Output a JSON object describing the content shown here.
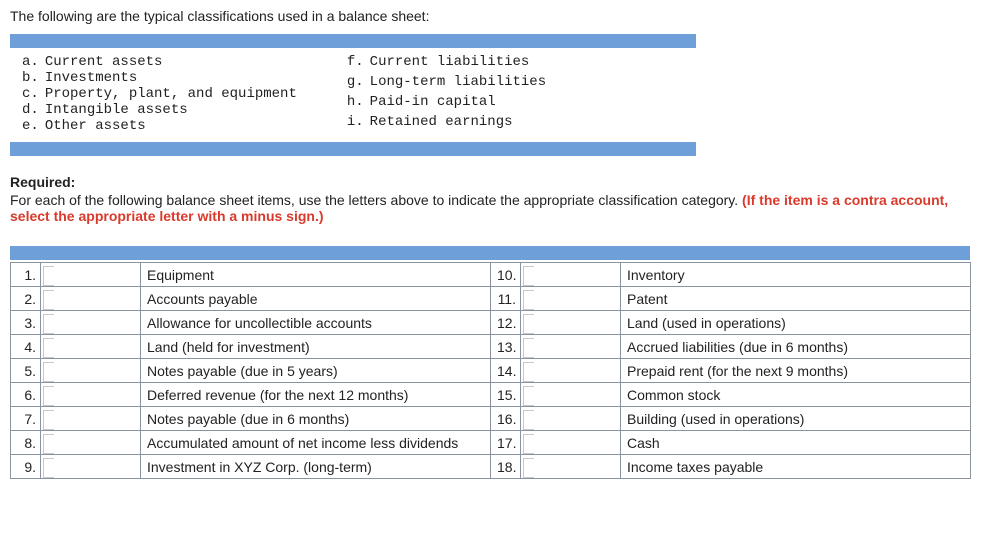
{
  "intro": "The following are the typical classifications used in a balance sheet:",
  "classifications_left": [
    {
      "letter": "a.",
      "label": "Current assets"
    },
    {
      "letter": "b.",
      "label": "Investments"
    },
    {
      "letter": "c.",
      "label": "Property, plant, and equipment"
    },
    {
      "letter": "d.",
      "label": "Intangible assets"
    },
    {
      "letter": "e.",
      "label": "Other assets"
    }
  ],
  "classifications_right": [
    {
      "letter": "f.",
      "label": "Current liabilities"
    },
    {
      "letter": "g.",
      "label": "Long-term liabilities"
    },
    {
      "letter": "h.",
      "label": "Paid-in capital"
    },
    {
      "letter": "i.",
      "label": "Retained earnings"
    }
  ],
  "required_heading": "Required:",
  "required_text": "For each of the following balance sheet items, use the letters above to indicate the appropriate classification category. ",
  "contra_note": "(If the item is a contra account, select the appropriate letter with a minus sign.)",
  "items_left": [
    {
      "num": "1.",
      "desc": "Equipment"
    },
    {
      "num": "2.",
      "desc": "Accounts payable"
    },
    {
      "num": "3.",
      "desc": "Allowance for uncollectible accounts"
    },
    {
      "num": "4.",
      "desc": "Land (held for investment)"
    },
    {
      "num": "5.",
      "desc": "Notes payable (due in 5 years)"
    },
    {
      "num": "6.",
      "desc": "Deferred revenue (for the next 12 months)"
    },
    {
      "num": "7.",
      "desc": "Notes payable (due in 6 months)"
    },
    {
      "num": "8.",
      "desc": "Accumulated amount of net income less dividends"
    },
    {
      "num": "9.",
      "desc": "Investment in XYZ Corp. (long-term)"
    }
  ],
  "items_right": [
    {
      "num": "10.",
      "desc": "Inventory"
    },
    {
      "num": "11.",
      "desc": "Patent"
    },
    {
      "num": "12.",
      "desc": "Land (used in operations)"
    },
    {
      "num": "13.",
      "desc": "Accrued liabilities (due in 6 months)"
    },
    {
      "num": "14.",
      "desc": "Prepaid rent (for the next 9 months)"
    },
    {
      "num": "15.",
      "desc": "Common stock"
    },
    {
      "num": "16.",
      "desc": "Building (used in operations)"
    },
    {
      "num": "17.",
      "desc": "Cash"
    },
    {
      "num": "18.",
      "desc": "Income taxes payable"
    }
  ]
}
